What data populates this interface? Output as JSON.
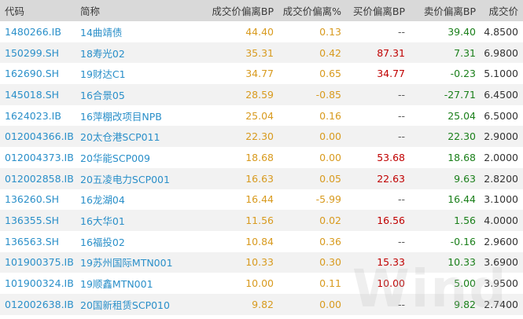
{
  "colors": {
    "header_bg": "#d9d9d9",
    "row_alt_bg": "#f2f2f2",
    "code_name_text": "#2a8fc9",
    "deviation_text": "#d89a1e",
    "buy_text": "#c00000",
    "sell_positive_text": "#1a7f1a",
    "sell_negative_text": "#1a7f1a",
    "empty_text": "#555555"
  },
  "table": {
    "headers": {
      "code": "代码",
      "name": "简称",
      "trade_dev_bp": "成交价偏离BP",
      "trade_dev_pct": "成交价偏离%",
      "buy_dev_bp": "买价偏离BP",
      "sell_dev_bp": "卖价偏离BP",
      "trade_yield": "成交价"
    },
    "rows": [
      {
        "code": "1480266.IB",
        "name": "14曲靖债",
        "trade_dev_bp": "44.40",
        "trade_dev_pct": "0.13",
        "buy_dev_bp": "--",
        "sell_dev_bp": "39.40",
        "trade_yield": "4.8500"
      },
      {
        "code": "150299.SH",
        "name": "18寿光02",
        "trade_dev_bp": "35.31",
        "trade_dev_pct": "0.42",
        "buy_dev_bp": "87.31",
        "sell_dev_bp": "7.31",
        "trade_yield": "6.9800"
      },
      {
        "code": "162690.SH",
        "name": "19财达C1",
        "trade_dev_bp": "34.77",
        "trade_dev_pct": "0.65",
        "buy_dev_bp": "34.77",
        "sell_dev_bp": "-0.23",
        "trade_yield": "5.1000"
      },
      {
        "code": "145018.SH",
        "name": "16合景05",
        "trade_dev_bp": "28.59",
        "trade_dev_pct": "-0.85",
        "buy_dev_bp": "--",
        "sell_dev_bp": "-27.71",
        "trade_yield": "6.4500"
      },
      {
        "code": "1624023.IB",
        "name": "16萍棚改项目NPB",
        "trade_dev_bp": "25.04",
        "trade_dev_pct": "0.16",
        "buy_dev_bp": "--",
        "sell_dev_bp": "25.04",
        "trade_yield": "6.5000"
      },
      {
        "code": "012004366.IB",
        "name": "20太仓港SCP011",
        "trade_dev_bp": "22.30",
        "trade_dev_pct": "0.00",
        "buy_dev_bp": "--",
        "sell_dev_bp": "22.30",
        "trade_yield": "2.9000"
      },
      {
        "code": "012004373.IB",
        "name": "20华能SCP009",
        "trade_dev_bp": "18.68",
        "trade_dev_pct": "0.00",
        "buy_dev_bp": "53.68",
        "sell_dev_bp": "18.68",
        "trade_yield": "2.0000"
      },
      {
        "code": "012002858.IB",
        "name": "20五凌电力SCP001",
        "trade_dev_bp": "16.63",
        "trade_dev_pct": "0.05",
        "buy_dev_bp": "22.63",
        "sell_dev_bp": "9.63",
        "trade_yield": "2.8200"
      },
      {
        "code": "136260.SH",
        "name": "16龙湖04",
        "trade_dev_bp": "16.44",
        "trade_dev_pct": "-5.99",
        "buy_dev_bp": "--",
        "sell_dev_bp": "16.44",
        "trade_yield": "3.1000"
      },
      {
        "code": "136355.SH",
        "name": "16大华01",
        "trade_dev_bp": "11.56",
        "trade_dev_pct": "0.02",
        "buy_dev_bp": "16.56",
        "sell_dev_bp": "1.56",
        "trade_yield": "4.0000"
      },
      {
        "code": "136563.SH",
        "name": "16福投02",
        "trade_dev_bp": "10.84",
        "trade_dev_pct": "0.36",
        "buy_dev_bp": "--",
        "sell_dev_bp": "-0.16",
        "trade_yield": "2.9600"
      },
      {
        "code": "101900375.IB",
        "name": "19苏州国际MTN001",
        "trade_dev_bp": "10.33",
        "trade_dev_pct": "0.30",
        "buy_dev_bp": "15.33",
        "sell_dev_bp": "10.33",
        "trade_yield": "3.6900"
      },
      {
        "code": "101900324.IB",
        "name": "19顺鑫MTN001",
        "trade_dev_bp": "10.00",
        "trade_dev_pct": "0.11",
        "buy_dev_bp": "10.00",
        "sell_dev_bp": "5.00",
        "trade_yield": "3.9500"
      },
      {
        "code": "012002638.IB",
        "name": "20国新租赁SCP010",
        "trade_dev_bp": "9.82",
        "trade_dev_pct": "0.00",
        "buy_dev_bp": "--",
        "sell_dev_bp": "9.82",
        "trade_yield": "2.7400"
      }
    ]
  },
  "watermark": {
    "text": "Wind"
  }
}
